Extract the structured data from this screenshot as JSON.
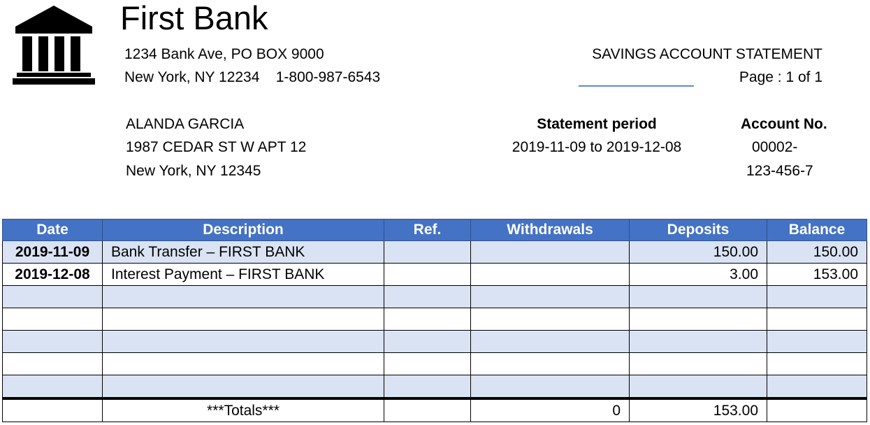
{
  "bank": {
    "name": "First Bank",
    "address_line1": "1234 Bank Ave, PO BOX 9000",
    "address_line2": "New York, NY 12234    1-800-987-6543",
    "logo_icon": "bank-building-icon"
  },
  "statement": {
    "type": "SAVINGS ACCOUNT STATEMENT",
    "page": "Page : 1 of 1",
    "period_label": "Statement period",
    "period_value": "2019-11-09 to 2019-12-08",
    "account_label": "Account No.",
    "account_value_line1": "00002-",
    "account_value_line2": "123-456-7"
  },
  "customer": {
    "name": "ALANDA GARCIA",
    "street": "1987 CEDAR ST W APT 12",
    "city": "New York, NY 12345"
  },
  "table": {
    "columns": [
      "Date",
      "Description",
      "Ref.",
      "Withdrawals",
      "Deposits",
      "Balance"
    ],
    "rows": [
      {
        "date": "2019-11-09",
        "description": "Bank Transfer – FIRST BANK",
        "ref": "",
        "withdrawals": "",
        "deposits": "150.00",
        "balance": "150.00"
      },
      {
        "date": "2019-12-08",
        "description": "Interest Payment – FIRST BANK",
        "ref": "",
        "withdrawals": "",
        "deposits": "3.00",
        "balance": "153.00"
      },
      {
        "date": "",
        "description": "",
        "ref": "",
        "withdrawals": "",
        "deposits": "",
        "balance": ""
      },
      {
        "date": "",
        "description": "",
        "ref": "",
        "withdrawals": "",
        "deposits": "",
        "balance": ""
      },
      {
        "date": "",
        "description": "",
        "ref": "",
        "withdrawals": "",
        "deposits": "",
        "balance": ""
      },
      {
        "date": "",
        "description": "",
        "ref": "",
        "withdrawals": "",
        "deposits": "",
        "balance": ""
      },
      {
        "date": "",
        "description": "",
        "ref": "",
        "withdrawals": "",
        "deposits": "",
        "balance": ""
      }
    ],
    "totals": {
      "label": "***Totals***",
      "withdrawals": "0",
      "deposits": "153.00"
    }
  },
  "colors": {
    "header_bg": "#4472c4",
    "stripe_bg": "#dae3f3"
  }
}
